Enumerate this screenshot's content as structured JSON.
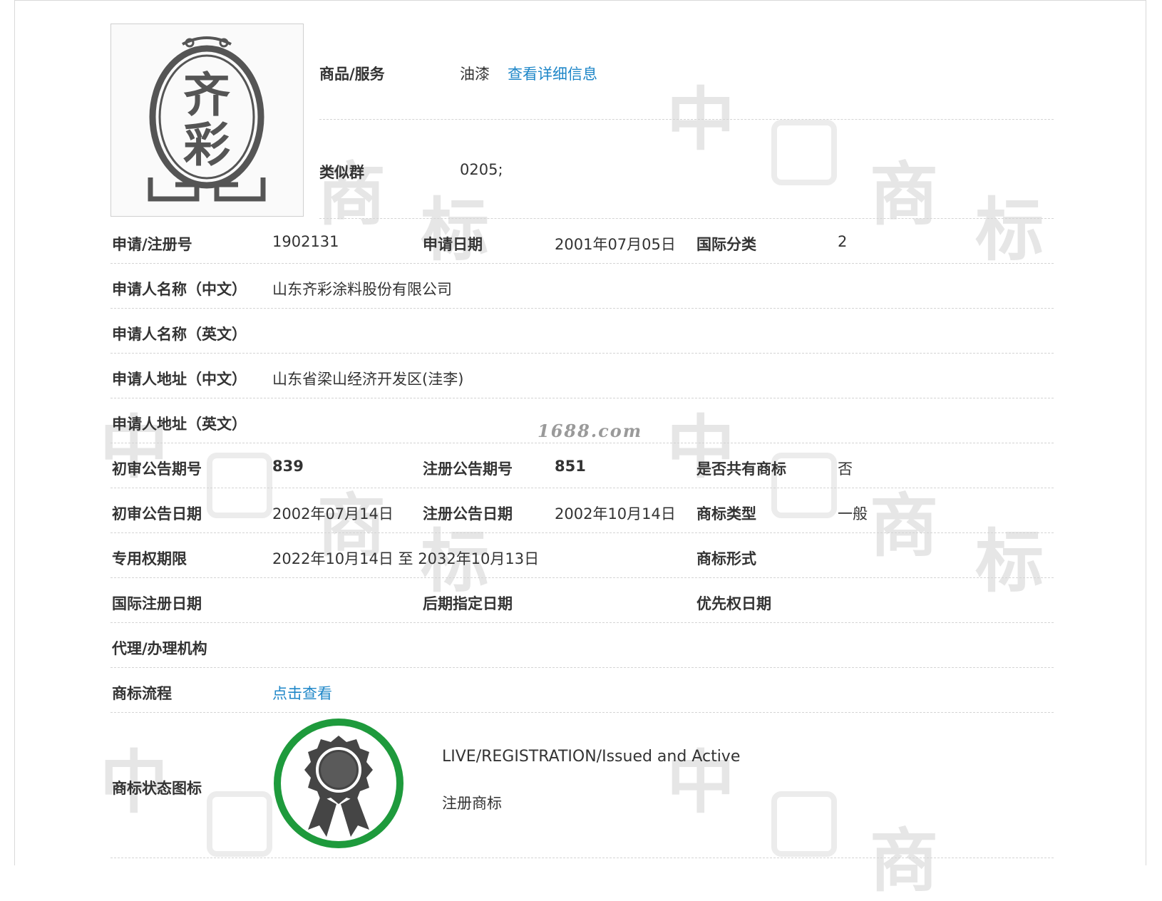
{
  "goods_services": {
    "label": "商品/服务",
    "value": "油漆",
    "detail_link": "查看详细信息"
  },
  "similar_group": {
    "label": "类似群",
    "value": "0205;"
  },
  "rows": {
    "reg_no": {
      "label": "申请/注册号",
      "value": "1902131"
    },
    "apply_date": {
      "label": "申请日期",
      "value": "2001年07月05日"
    },
    "intl_class": {
      "label": "国际分类",
      "value": "2"
    },
    "applicant_cn": {
      "label": "申请人名称（中文）",
      "value": "山东齐彩涂料股份有限公司"
    },
    "applicant_en": {
      "label": "申请人名称（英文）",
      "value": ""
    },
    "address_cn": {
      "label": "申请人地址（中文）",
      "value": "山东省梁山经济开发区(洼李)"
    },
    "address_en": {
      "label": "申请人地址（英文）",
      "value": ""
    },
    "prelim_no": {
      "label": "初审公告期号",
      "value": "839"
    },
    "reg_pub_no": {
      "label": "注册公告期号",
      "value": "851"
    },
    "shared": {
      "label": "是否共有商标",
      "value": "否"
    },
    "prelim_date": {
      "label": "初审公告日期",
      "value": "2002年07月14日"
    },
    "reg_pub_date": {
      "label": "注册公告日期",
      "value": "2002年10月14日"
    },
    "mark_type": {
      "label": "商标类型",
      "value": "一般"
    },
    "exclusive_period": {
      "label": "专用权期限",
      "value": "2022年10月14日 至 2032年10月13日"
    },
    "mark_form": {
      "label": "商标形式",
      "value": ""
    },
    "intl_reg_date": {
      "label": "国际注册日期",
      "value": ""
    },
    "later_designation": {
      "label": "后期指定日期",
      "value": ""
    },
    "priority_date": {
      "label": "优先权日期",
      "value": ""
    },
    "agent": {
      "label": "代理/办理机构",
      "value": ""
    },
    "process": {
      "label": "商标流程",
      "link": "点击查看"
    },
    "status_icon": {
      "label": "商标状态图标"
    }
  },
  "status": {
    "en": "LIVE/REGISTRATION/Issued and Active",
    "cn": "注册商标",
    "ring_color": "#1e9a3c",
    "icon": "award-ribbon-icon"
  },
  "trademark_image": {
    "text_top": "齐",
    "text_bottom": "彩",
    "icon": "trademark-logo"
  },
  "watermark": {
    "site": "1688.com",
    "chars": [
      "中",
      "国",
      "商",
      "标"
    ]
  },
  "colors": {
    "link": "#1f87c8",
    "label": "#333333",
    "separator": "#d4d4d4"
  }
}
